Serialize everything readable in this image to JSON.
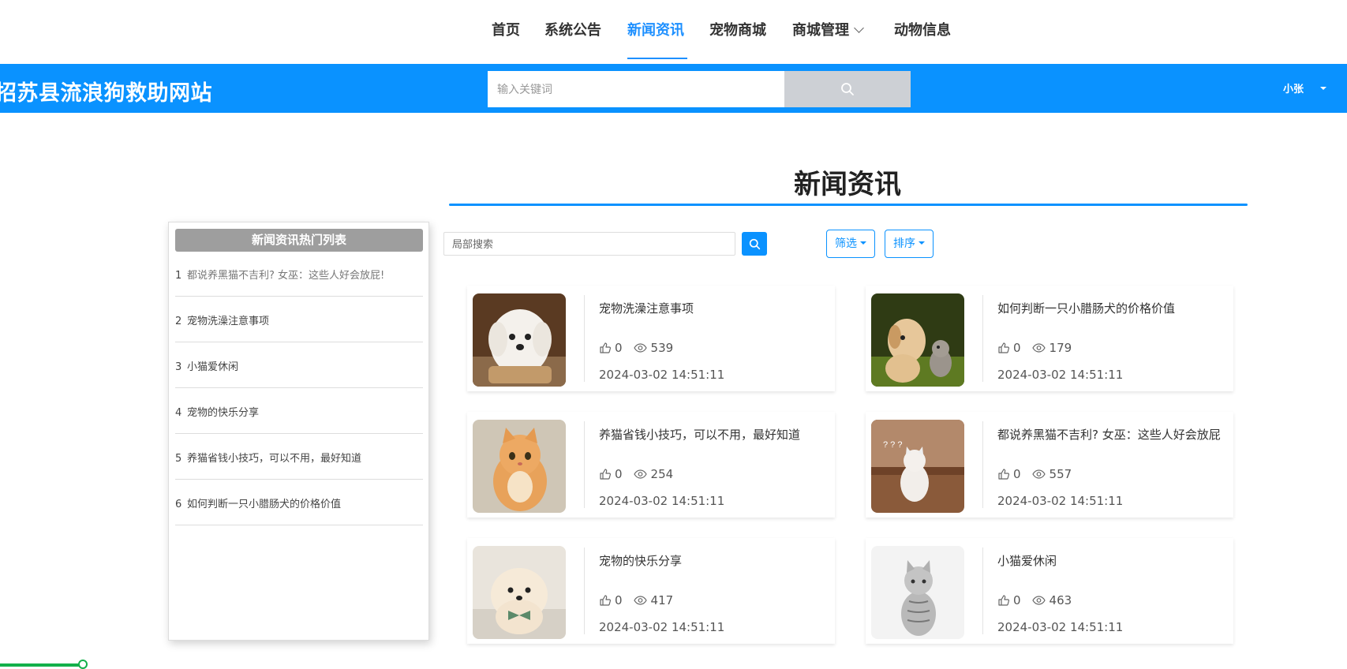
{
  "nav": {
    "items": [
      {
        "label": "首页",
        "active": false
      },
      {
        "label": "系统公告",
        "active": false
      },
      {
        "label": "新闻资讯",
        "active": true
      },
      {
        "label": "宠物商城",
        "active": false
      },
      {
        "label": "商城管理",
        "active": false,
        "has_dropdown": true
      },
      {
        "label": "动物信息",
        "active": false
      }
    ]
  },
  "header": {
    "site_title": "招苏县流浪狗救助网站",
    "search_placeholder": "输入关键词",
    "user_name": "小张"
  },
  "page": {
    "title": "新闻资讯"
  },
  "hot_list": {
    "header": "新闻资讯热门列表",
    "items": [
      {
        "index": "1",
        "title": "都说养黑猫不吉利? 女巫：这些人好会放屁!"
      },
      {
        "index": "2",
        "title": "宠物洗澡注意事项"
      },
      {
        "index": "3",
        "title": "小猫爱休闲"
      },
      {
        "index": "4",
        "title": "宠物的快乐分享"
      },
      {
        "index": "5",
        "title": "养猫省钱小技巧，可以不用，最好知道"
      },
      {
        "index": "6",
        "title": "如何判断一只小腊肠犬的价格价值"
      }
    ]
  },
  "toolbar": {
    "local_search_placeholder": "局部搜索",
    "filter_label": "筛选",
    "sort_label": "排序"
  },
  "cards": [
    {
      "title": "宠物洗澡注意事项",
      "likes": "0",
      "views": "539",
      "date": "2024-03-02 14:51:11",
      "image": "white-maltese-dog"
    },
    {
      "title": "如何判断一只小腊肠犬的价格价值",
      "likes": "0",
      "views": "179",
      "date": "2024-03-02 14:51:11",
      "image": "puppy-and-kitten"
    },
    {
      "title": "养猫省钱小技巧，可以不用，最好知道",
      "likes": "0",
      "views": "254",
      "date": "2024-03-02 14:51:11",
      "image": "orange-cat"
    },
    {
      "title": "都说养黑猫不吉利? 女巫：这些人好会放屁",
      "likes": "0",
      "views": "557",
      "date": "2024-03-02 14:51:11",
      "image": "white-cat-on-steps"
    },
    {
      "title": "宠物的快乐分享",
      "likes": "0",
      "views": "417",
      "date": "2024-03-02 14:51:11",
      "image": "pomeranian-with-bowtie"
    },
    {
      "title": "小猫爱休闲",
      "likes": "0",
      "views": "463",
      "date": "2024-03-02 14:51:11",
      "image": "silver-tabby-cat"
    }
  ],
  "media_progress": {
    "value": 0.9
  },
  "colors": {
    "accent": "#0a92ff",
    "progress": "#13b04a"
  }
}
